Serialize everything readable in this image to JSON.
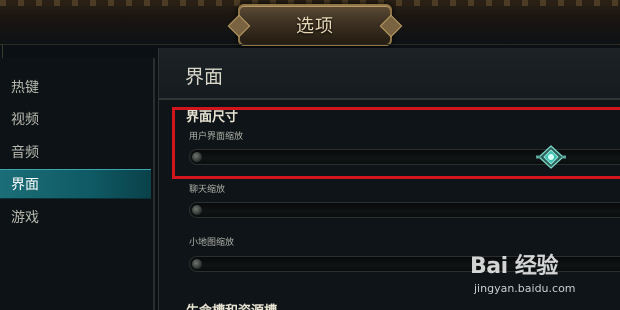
{
  "window": {
    "title": "选项"
  },
  "sidebar": {
    "items": [
      {
        "label": "热键",
        "active": false
      },
      {
        "label": "视频",
        "active": false
      },
      {
        "label": "音频",
        "active": false
      },
      {
        "label": "界面",
        "active": true
      },
      {
        "label": "游戏",
        "active": false
      }
    ]
  },
  "main": {
    "title": "界面",
    "section_title": "界面尺寸",
    "sliders": [
      {
        "label": "用户界面缩放",
        "has_knob": true,
        "value_fraction": 0.85
      },
      {
        "label": "聊天缩放",
        "has_knob": false
      },
      {
        "label": "小地图缩放",
        "has_knob": false
      }
    ],
    "next_section_partial": "生命槽和资源槽"
  },
  "watermark": {
    "logo": "Bai 经验",
    "url": "jingyan.baidu.com"
  },
  "colors": {
    "active_tab": "#156b75",
    "highlight_box": "#d2141d",
    "knob_accent": "#3fc0b2"
  }
}
